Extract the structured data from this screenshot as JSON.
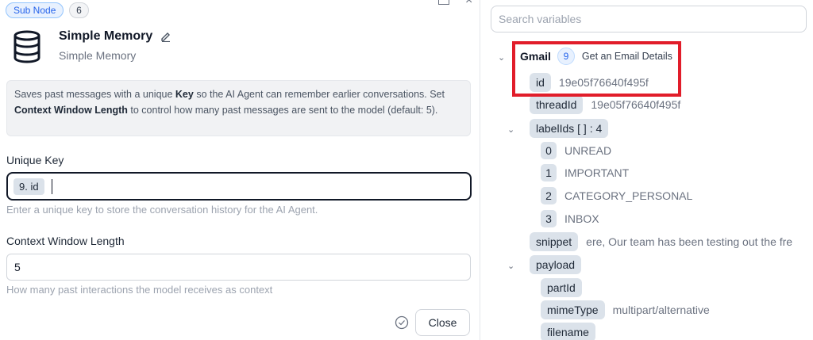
{
  "node": {
    "sub_node_badge": "Sub Node",
    "badge_count": "6",
    "title": "Simple Memory",
    "subtitle": "Simple Memory"
  },
  "info": {
    "part1": "Saves past messages with a unique ",
    "bold1": "Key",
    "part2": " so the AI Agent can remember earlier conversations. Set ",
    "bold2": "Context Window Length",
    "part3": " to control how many past messages are sent to the model (default: 5)."
  },
  "fields": {
    "unique_key_label": "Unique Key",
    "unique_key_chip": "9. id",
    "unique_key_hint": "Enter a unique key to store the conversation history for the AI Agent.",
    "context_label": "Context Window Length",
    "context_value": "5",
    "context_hint": "How many past interactions the model receives as context"
  },
  "footer": {
    "close_label": "Close"
  },
  "variables": {
    "search_placeholder": "Search variables",
    "source_name": "Gmail",
    "source_count": "9",
    "source_desc": "Get an Email Details",
    "items": [
      {
        "key": "id",
        "value": "19e05f76640f495f"
      },
      {
        "key": "threadId",
        "value": "19e05f76640f495f"
      },
      {
        "key": "labelIds [ ] : 4",
        "value": ""
      },
      {
        "key": "snippet",
        "value": "ere, Our team has been testing out the fre"
      },
      {
        "key": "payload",
        "value": ""
      },
      {
        "key": "partId",
        "value": ""
      },
      {
        "key": "mimeType",
        "value": "multipart/alternative"
      },
      {
        "key": "filename",
        "value": ""
      }
    ],
    "labels": [
      {
        "index": "0",
        "value": "UNREAD"
      },
      {
        "index": "1",
        "value": "IMPORTANT"
      },
      {
        "index": "2",
        "value": "CATEGORY_PERSONAL"
      },
      {
        "index": "3",
        "value": "INBOX"
      }
    ]
  },
  "colors": {
    "highlight": "#e11d2a",
    "accent": "#2563eb",
    "pill": "#dbe2ea"
  }
}
